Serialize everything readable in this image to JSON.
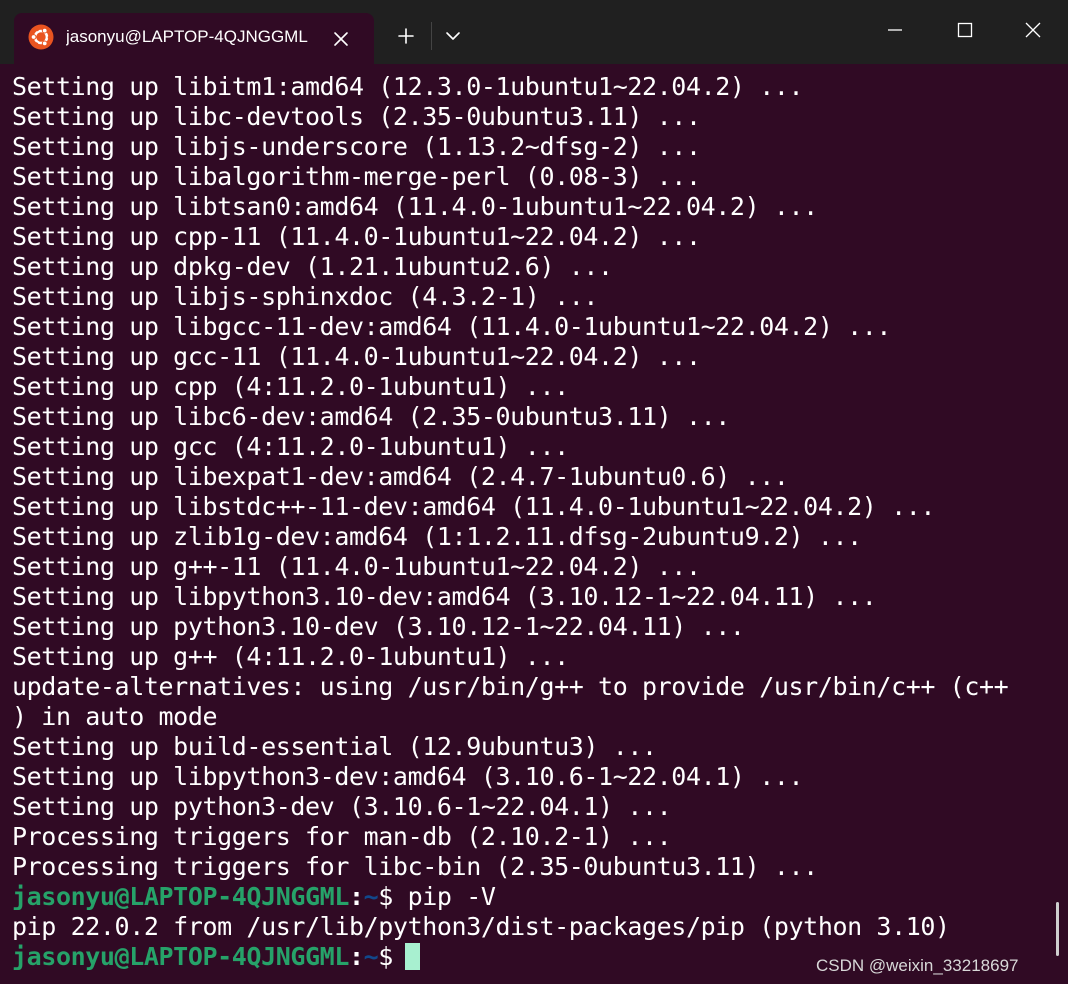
{
  "titlebar": {
    "tab_title": "jasonyu@LAPTOP-4QJNGGML",
    "tab_icon": "ubuntu-logo-icon",
    "new_tab_icon": "plus-icon",
    "dropdown_icon": "chevron-down-icon",
    "accent_color": "#e95420"
  },
  "terminal": {
    "background_color": "#300a24",
    "lines": [
      "Setting up libitm1:amd64 (12.3.0-1ubuntu1~22.04.2) ...",
      "Setting up libc-devtools (2.35-0ubuntu3.11) ...",
      "Setting up libjs-underscore (1.13.2~dfsg-2) ...",
      "Setting up libalgorithm-merge-perl (0.08-3) ...",
      "Setting up libtsan0:amd64 (11.4.0-1ubuntu1~22.04.2) ...",
      "Setting up cpp-11 (11.4.0-1ubuntu1~22.04.2) ...",
      "Setting up dpkg-dev (1.21.1ubuntu2.6) ...",
      "Setting up libjs-sphinxdoc (4.3.2-1) ...",
      "Setting up libgcc-11-dev:amd64 (11.4.0-1ubuntu1~22.04.2) ...",
      "Setting up gcc-11 (11.4.0-1ubuntu1~22.04.2) ...",
      "Setting up cpp (4:11.2.0-1ubuntu1) ...",
      "Setting up libc6-dev:amd64 (2.35-0ubuntu3.11) ...",
      "Setting up gcc (4:11.2.0-1ubuntu1) ...",
      "Setting up libexpat1-dev:amd64 (2.4.7-1ubuntu0.6) ...",
      "Setting up libstdc++-11-dev:amd64 (11.4.0-1ubuntu1~22.04.2) ...",
      "Setting up zlib1g-dev:amd64 (1:1.2.11.dfsg-2ubuntu9.2) ...",
      "Setting up g++-11 (11.4.0-1ubuntu1~22.04.2) ...",
      "Setting up libpython3.10-dev:amd64 (3.10.12-1~22.04.11) ...",
      "Setting up python3.10-dev (3.10.12-1~22.04.11) ...",
      "Setting up g++ (4:11.2.0-1ubuntu1) ...",
      "update-alternatives: using /usr/bin/g++ to provide /usr/bin/c++ (c++",
      ") in auto mode",
      "Setting up build-essential (12.9ubuntu3) ...",
      "Setting up libpython3-dev:amd64 (3.10.6-1~22.04.1) ...",
      "Setting up python3-dev (3.10.6-1~22.04.1) ...",
      "Processing triggers for man-db (2.10.2-1) ...",
      "Processing triggers for libc-bin (2.35-0ubuntu3.11) ..."
    ],
    "prompt1": {
      "user": "jasonyu@LAPTOP-4QJNGGML",
      "sep": ":",
      "path": "~",
      "dollar": "$",
      "command": " pip -V"
    },
    "output": "pip 22.0.2 from /usr/lib/python3/dist-packages/pip (python 3.10)",
    "prompt2": {
      "user": "jasonyu@LAPTOP-4QJNGGML",
      "sep": ":",
      "path": "~",
      "dollar": "$"
    },
    "colors": {
      "prompt_user": "#26a269",
      "prompt_path": "#12488b",
      "cursor": "#a8f0d0"
    }
  },
  "watermark": "CSDN @weixin_33218697"
}
